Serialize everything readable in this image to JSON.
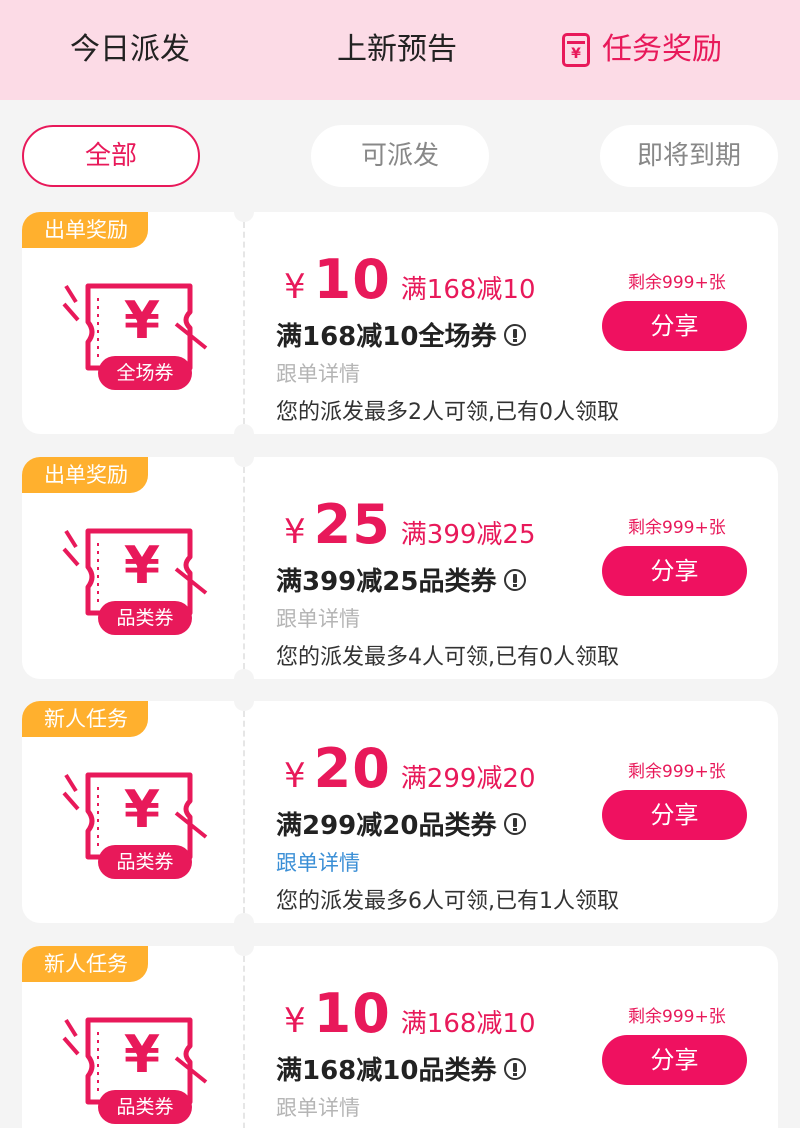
{
  "top_tabs": [
    {
      "label": "今日派发",
      "active": false
    },
    {
      "label": "上新预告",
      "active": false
    },
    {
      "label": "任务奖励",
      "active": true,
      "icon": "red-envelope-icon",
      "icon_glyph": "¥"
    }
  ],
  "filters": [
    {
      "label": "全部",
      "active": true
    },
    {
      "label": "可派发",
      "active": false
    },
    {
      "label": "即将到期",
      "active": false
    }
  ],
  "coupons": [
    {
      "tag": "出单奖励",
      "badge": "全场券",
      "yen": "¥",
      "amount": "10",
      "condition": "满168减10",
      "title": "满168减10全场券",
      "follow": "跟单详情",
      "follow_link": false,
      "limit": "您的派发最多2人可领,已有0人领取",
      "remaining": "剩余999+张",
      "share_label": "分享"
    },
    {
      "tag": "出单奖励",
      "badge": "品类券",
      "yen": "¥",
      "amount": "25",
      "condition": "满399减25",
      "title": "满399减25品类券",
      "follow": "跟单详情",
      "follow_link": false,
      "limit": "您的派发最多4人可领,已有0人领取",
      "remaining": "剩余999+张",
      "share_label": "分享"
    },
    {
      "tag": "新人任务",
      "badge": "品类券",
      "yen": "¥",
      "amount": "20",
      "condition": "满299减20",
      "title": "满299减20品类券",
      "follow": "跟单详情",
      "follow_link": true,
      "limit": "您的派发最多6人可领,已有1人领取",
      "remaining": "剩余999+张",
      "share_label": "分享"
    },
    {
      "tag": "新人任务",
      "badge": "品类券",
      "yen": "¥",
      "amount": "10",
      "condition": "满168减10",
      "title": "满168减10品类券",
      "follow": "跟单详情",
      "follow_link": false,
      "limit": "",
      "remaining": "剩余999+张",
      "share_label": "分享"
    }
  ],
  "colors": {
    "accent": "#e8195a",
    "header_bg": "#fcdbe6",
    "tag_bg": "#ffb02e",
    "link": "#3b8fd6"
  }
}
